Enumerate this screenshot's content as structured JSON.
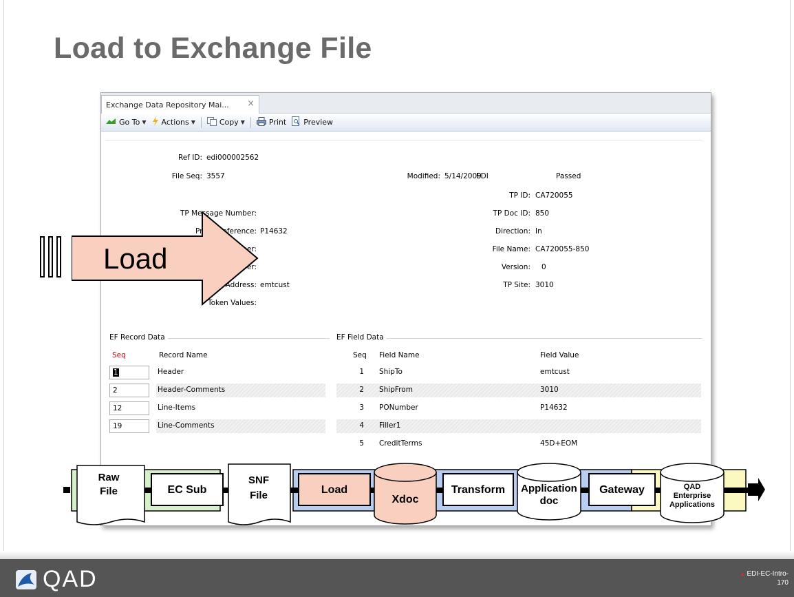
{
  "slide": {
    "title": "Load to Exchange File",
    "footer_logo": "QAD",
    "slide_id_line1": "EDI-EC-Intro-",
    "slide_id_line2": "170"
  },
  "window": {
    "tab_title": "Exchange Data Repository Mai...",
    "tab_close": "×",
    "toolbar": [
      {
        "label": "Go To",
        "icon": "goto-icon",
        "dropdown": true
      },
      {
        "label": "Actions",
        "icon": "actions-icon",
        "dropdown": true
      },
      {
        "label": "Copy",
        "icon": "copy-icon",
        "dropdown": true
      },
      {
        "label": "Print",
        "icon": "print-icon",
        "dropdown": false
      },
      {
        "label": "Preview",
        "icon": "preview-icon",
        "dropdown": false
      }
    ]
  },
  "header_fields": {
    "ref_id_label": "Ref ID:",
    "ref_id": "edi000002562",
    "file_seq_label": "File Seq:",
    "file_seq": "3557",
    "modified_label": "Modified:",
    "modified": "5/14/2009",
    "edi_label": "EDI",
    "edi_status": "Passed",
    "tp_id_label": "TP ID:",
    "tp_id": "CA720055",
    "tp_doc_id_label": "TP Doc ID:",
    "tp_doc_id": "850",
    "direction_label": "Direction:",
    "direction": "In",
    "file_name_label": "File Name:",
    "file_name": "CA720055-850",
    "version_label": "Version:",
    "version": "0",
    "tp_site_label": "TP Site:",
    "tp_site": "3010",
    "tp_message_number_label": "TP Message Number:",
    "reference_label": "Reference:",
    "reference_prefix": "Pr",
    "reference": "P14632",
    "number1_label": "mber:",
    "number2_label": "mber:",
    "address_label": "P Address:",
    "address": "emtcust",
    "token_values_label": "Token Values:"
  },
  "ef_record": {
    "section_label": "EF Record Data",
    "col_seq": "Seq",
    "col_name": "Record Name",
    "rows": [
      {
        "seq": "1",
        "name": "Header"
      },
      {
        "seq": "2",
        "name": "Header-Comments"
      },
      {
        "seq": "12",
        "name": "Line-Items"
      },
      {
        "seq": "19",
        "name": "Line-Comments"
      }
    ]
  },
  "ef_field": {
    "section_label": "EF Field Data",
    "col_seq": "Seq",
    "col_name": "Field Name",
    "col_value": "Field Value",
    "rows": [
      {
        "seq": "1",
        "name": "ShipTo",
        "value": "emtcust"
      },
      {
        "seq": "2",
        "name": "ShipFrom",
        "value": "3010"
      },
      {
        "seq": "3",
        "name": "PONumber",
        "value": "P14632"
      },
      {
        "seq": "4",
        "name": "Filler1",
        "value": ""
      },
      {
        "seq": "5",
        "name": "CreditTerms",
        "value": "45D+EOM"
      }
    ]
  },
  "overlay": {
    "load_label": "Load"
  },
  "flow": {
    "raw_file_1": "Raw",
    "raw_file_2": "File",
    "ec_sub": "EC Sub",
    "snf_file_1": "SNF",
    "snf_file_2": "File",
    "load": "Load",
    "xdoc": "Xdoc",
    "transform": "Transform",
    "app_doc_1": "Application",
    "app_doc_2": "doc",
    "gateway": "Gateway",
    "qad_1": "QAD",
    "qad_2": "Enterprise",
    "qad_3": "Applications"
  },
  "colors": {
    "title": "#6a6a6a",
    "load_fill": "#f9d0bf",
    "green_band": "#d6f0cc",
    "blue_band": "#b8cdf0",
    "yellow_band": "#fbf8c0",
    "footer": "#555555",
    "seq_header_red": "#cc0000"
  }
}
